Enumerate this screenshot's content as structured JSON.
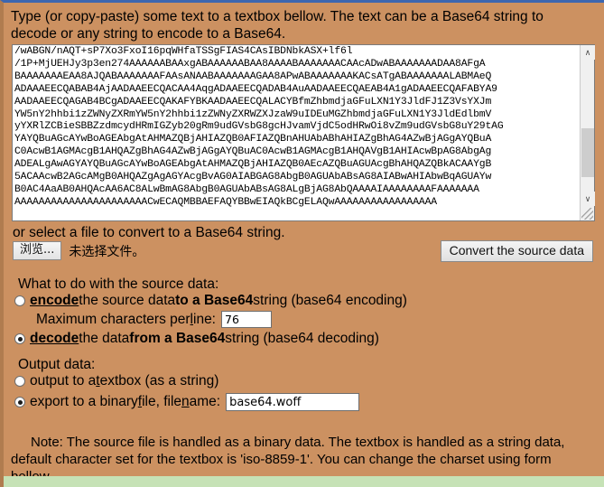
{
  "intro": {
    "line1": "Type (or copy-paste) some text to a textbox bellow. The text can be a Base64 string to",
    "line2": "decode or any string to encode to a Base64."
  },
  "source_textarea": {
    "value": "/wABGN/nAQT+sP7Xo3FxoI16pqWHfaTSSgFIAS4CAsIBDNbkASX+lf6l\n/1P+MjUEHJy3p3en274AAAAAABAAxgABAAAAAABAA8AAAABAAAAAAACAAcADwABAAAAAAADAA8AFgA\nBAAAAAAAEAA8AJQABAAAAAAAFAAsANAABAAAAAAAGAA8APwABAAAAAAAKACsATgABAAAAAAALABMAeQ\nADAAAEECQABAB4AjAADAAEECQACAA4AqgADAAEECQADAB4AuAADAAEECQAEAB4A1gADAAEECQAFABYA9\nAADAAEECQAGAB4BCgADAAEECQAKAFYBKAADAAEECQALACYBfmZhbmdjaGFuLXN1Y3JldFJ1Z3VsYXJm\nYW5nY2hhbi1zZWNyZXRmYW5nY2hhbi1zZWNyZXRWZXJzaW9uIDEuMGZhbmdjaGFuLXN1Y3JldEdlbmV\nyYXRlZCBieSBBZzdmcydHRmIGZyb20gRm9udGVsbG8gcHJvamVjdC5odHRwOi8vZm9udGVsbG8uY29tAG\nYAYQBuAGcAYwBoAGEAbgAtAHMAZQBjAHIAZQB0AFIAZQBnAHUAbABhAHIAZgBhAG4AZwBjAGgAYQBuA\nC0AcwB1AGMAcgB1AHQAZgBhAG4AZwBjAGgAYQBuAC0AcwB1AGMAcgB1AHQAVgB1AHIAcwBpAG8AbgAg\nADEALgAwAGYAYQBuAGcAYwBoAGEAbgAtAHMAZQBjAHIAZQB0AEcAZQBuAGUAcgBhAHQAZQBkACAAYgB\n5ACAAcwB2AGcAMgB0AHQAZgAgAGYAcgBvAG0AIABGAG8AbgB0AGUAbABsAG8AIABwAHIAbwBqAGUAYw\nB0AC4AaAB0AHQAcAA6AC8ALwBmAG8AbgB0AGUAbABsAG8ALgBjAG8AbQAAAAIAAAAAAAAFAAAAAAA\nAAAAAAAAAAAAAAAAAAAAAACwECAQMBBAEFAQYBBwEIAQkBCgELAQwAAAAAAAAAAAAAAAAA",
    "scrollbar": {
      "up_arrow": "∧",
      "down_arrow": "∨"
    }
  },
  "file_section": {
    "label": "or select a file to convert to a Base64 string.",
    "browse_button": "浏览...",
    "no_file_text": "未选择文件。",
    "convert_button": "Convert the source data"
  },
  "what_to_do": {
    "title": "What to do with the source data:",
    "encode": {
      "checked": false,
      "t1": "encode",
      "t2": " the source data ",
      "t3": "to a Base64",
      "t4": " string (base64 encoding)"
    },
    "max_chars": {
      "label_a": "Maximum characters per ",
      "label_b": "l",
      "label_c": "ine:",
      "value": "76"
    },
    "decode": {
      "checked": true,
      "t1": "decode",
      "t2": " the data ",
      "t3": "from a Base64",
      "t4": " string (base64 decoding)"
    }
  },
  "output_data": {
    "title": "Output data:",
    "textbox": {
      "checked": false,
      "t1": "output to a ",
      "t2": "t",
      "t3": "extbox (as a string)"
    },
    "binary": {
      "checked": true,
      "t1": "export to a binary ",
      "t2": "f",
      "t3": "ile, file",
      "t4": "n",
      "t5": "ame:",
      "filename_value": "base64.woff"
    }
  },
  "note": {
    "line1": "Note: The source file is handled as a binary data. The textbox is handled as a string data,",
    "line2": "default character set for the textbox is 'iso-8859-1'. You can change the charset using form",
    "line3": "bellow."
  },
  "colors": {
    "page_background": "#cc9161",
    "top_border": "#3c66b0",
    "bottom_band": "#c6e2b6"
  }
}
